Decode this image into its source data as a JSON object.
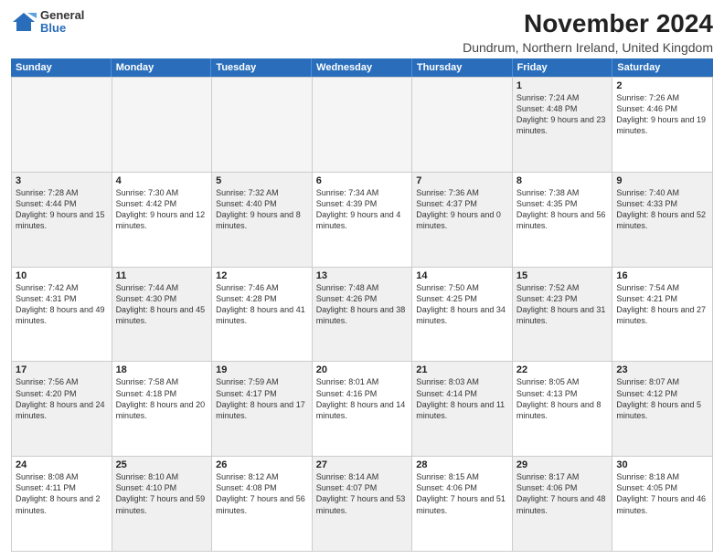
{
  "logo": {
    "general": "General",
    "blue": "Blue"
  },
  "title": "November 2024",
  "subtitle": "Dundrum, Northern Ireland, United Kingdom",
  "header_days": [
    "Sunday",
    "Monday",
    "Tuesday",
    "Wednesday",
    "Thursday",
    "Friday",
    "Saturday"
  ],
  "weeks": [
    [
      {
        "day": "",
        "text": "",
        "empty": true
      },
      {
        "day": "",
        "text": "",
        "empty": true
      },
      {
        "day": "",
        "text": "",
        "empty": true
      },
      {
        "day": "",
        "text": "",
        "empty": true
      },
      {
        "day": "",
        "text": "",
        "empty": true
      },
      {
        "day": "1",
        "text": "Sunrise: 7:24 AM\nSunset: 4:48 PM\nDaylight: 9 hours and 23 minutes.",
        "shaded": true
      },
      {
        "day": "2",
        "text": "Sunrise: 7:26 AM\nSunset: 4:46 PM\nDaylight: 9 hours and 19 minutes.",
        "shaded": false
      }
    ],
    [
      {
        "day": "3",
        "text": "Sunrise: 7:28 AM\nSunset: 4:44 PM\nDaylight: 9 hours and 15 minutes.",
        "shaded": true
      },
      {
        "day": "4",
        "text": "Sunrise: 7:30 AM\nSunset: 4:42 PM\nDaylight: 9 hours and 12 minutes.",
        "shaded": false
      },
      {
        "day": "5",
        "text": "Sunrise: 7:32 AM\nSunset: 4:40 PM\nDaylight: 9 hours and 8 minutes.",
        "shaded": true
      },
      {
        "day": "6",
        "text": "Sunrise: 7:34 AM\nSunset: 4:39 PM\nDaylight: 9 hours and 4 minutes.",
        "shaded": false
      },
      {
        "day": "7",
        "text": "Sunrise: 7:36 AM\nSunset: 4:37 PM\nDaylight: 9 hours and 0 minutes.",
        "shaded": true
      },
      {
        "day": "8",
        "text": "Sunrise: 7:38 AM\nSunset: 4:35 PM\nDaylight: 8 hours and 56 minutes.",
        "shaded": false
      },
      {
        "day": "9",
        "text": "Sunrise: 7:40 AM\nSunset: 4:33 PM\nDaylight: 8 hours and 52 minutes.",
        "shaded": true
      }
    ],
    [
      {
        "day": "10",
        "text": "Sunrise: 7:42 AM\nSunset: 4:31 PM\nDaylight: 8 hours and 49 minutes.",
        "shaded": false
      },
      {
        "day": "11",
        "text": "Sunrise: 7:44 AM\nSunset: 4:30 PM\nDaylight: 8 hours and 45 minutes.",
        "shaded": true
      },
      {
        "day": "12",
        "text": "Sunrise: 7:46 AM\nSunset: 4:28 PM\nDaylight: 8 hours and 41 minutes.",
        "shaded": false
      },
      {
        "day": "13",
        "text": "Sunrise: 7:48 AM\nSunset: 4:26 PM\nDaylight: 8 hours and 38 minutes.",
        "shaded": true
      },
      {
        "day": "14",
        "text": "Sunrise: 7:50 AM\nSunset: 4:25 PM\nDaylight: 8 hours and 34 minutes.",
        "shaded": false
      },
      {
        "day": "15",
        "text": "Sunrise: 7:52 AM\nSunset: 4:23 PM\nDaylight: 8 hours and 31 minutes.",
        "shaded": true
      },
      {
        "day": "16",
        "text": "Sunrise: 7:54 AM\nSunset: 4:21 PM\nDaylight: 8 hours and 27 minutes.",
        "shaded": false
      }
    ],
    [
      {
        "day": "17",
        "text": "Sunrise: 7:56 AM\nSunset: 4:20 PM\nDaylight: 8 hours and 24 minutes.",
        "shaded": true
      },
      {
        "day": "18",
        "text": "Sunrise: 7:58 AM\nSunset: 4:18 PM\nDaylight: 8 hours and 20 minutes.",
        "shaded": false
      },
      {
        "day": "19",
        "text": "Sunrise: 7:59 AM\nSunset: 4:17 PM\nDaylight: 8 hours and 17 minutes.",
        "shaded": true
      },
      {
        "day": "20",
        "text": "Sunrise: 8:01 AM\nSunset: 4:16 PM\nDaylight: 8 hours and 14 minutes.",
        "shaded": false
      },
      {
        "day": "21",
        "text": "Sunrise: 8:03 AM\nSunset: 4:14 PM\nDaylight: 8 hours and 11 minutes.",
        "shaded": true
      },
      {
        "day": "22",
        "text": "Sunrise: 8:05 AM\nSunset: 4:13 PM\nDaylight: 8 hours and 8 minutes.",
        "shaded": false
      },
      {
        "day": "23",
        "text": "Sunrise: 8:07 AM\nSunset: 4:12 PM\nDaylight: 8 hours and 5 minutes.",
        "shaded": true
      }
    ],
    [
      {
        "day": "24",
        "text": "Sunrise: 8:08 AM\nSunset: 4:11 PM\nDaylight: 8 hours and 2 minutes.",
        "shaded": false
      },
      {
        "day": "25",
        "text": "Sunrise: 8:10 AM\nSunset: 4:10 PM\nDaylight: 7 hours and 59 minutes.",
        "shaded": true
      },
      {
        "day": "26",
        "text": "Sunrise: 8:12 AM\nSunset: 4:08 PM\nDaylight: 7 hours and 56 minutes.",
        "shaded": false
      },
      {
        "day": "27",
        "text": "Sunrise: 8:14 AM\nSunset: 4:07 PM\nDaylight: 7 hours and 53 minutes.",
        "shaded": true
      },
      {
        "day": "28",
        "text": "Sunrise: 8:15 AM\nSunset: 4:06 PM\nDaylight: 7 hours and 51 minutes.",
        "shaded": false
      },
      {
        "day": "29",
        "text": "Sunrise: 8:17 AM\nSunset: 4:06 PM\nDaylight: 7 hours and 48 minutes.",
        "shaded": true
      },
      {
        "day": "30",
        "text": "Sunrise: 8:18 AM\nSunset: 4:05 PM\nDaylight: 7 hours and 46 minutes.",
        "shaded": false
      }
    ]
  ]
}
